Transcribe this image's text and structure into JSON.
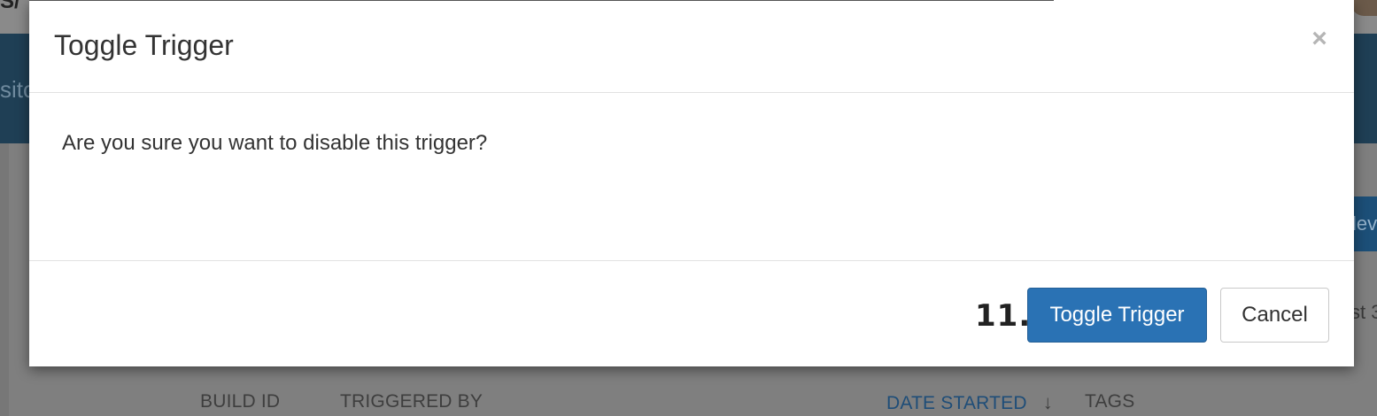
{
  "background": {
    "header_fragment": "sito",
    "view_button_fragment": "lev",
    "last_fragment": "st 3",
    "logo_fragment": "S/",
    "columns": {
      "build_id": "BUILD ID",
      "triggered_by": "TRIGGERED BY",
      "date_started": "DATE STARTED",
      "tags": "TAGS"
    }
  },
  "modal": {
    "title": "Toggle Trigger",
    "close_glyph": "×",
    "message": "Are you sure you want to disable this trigger?",
    "step_label": "11.",
    "confirm_label": "Toggle Trigger",
    "cancel_label": "Cancel"
  },
  "colors": {
    "primary": "#2a72b4",
    "header_bg": "#1f3f55",
    "overlay": "#7f7f7f"
  },
  "icons": {
    "sort": "arrow-down-icon",
    "close": "close-icon"
  }
}
